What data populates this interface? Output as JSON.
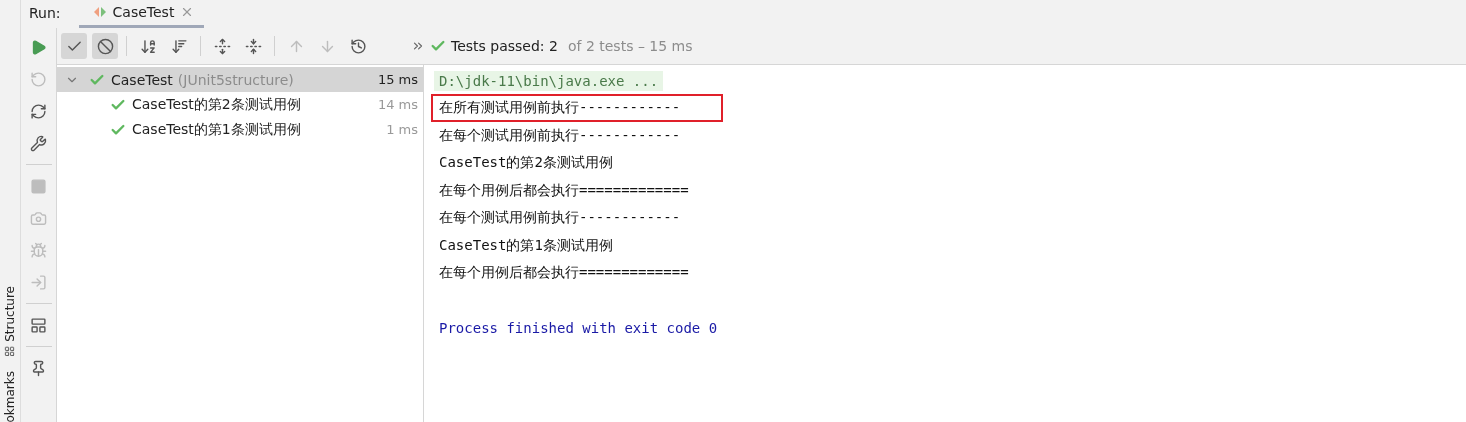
{
  "side_tabs": [
    {
      "label": "Structure"
    },
    {
      "label": "okmarks"
    }
  ],
  "run_bar": {
    "label": "Run:",
    "tab": {
      "label": "CaseTest",
      "selected": true
    }
  },
  "toolbar_buttons": [
    {
      "toggled": true,
      "disabled": false
    },
    {
      "toggled": true,
      "disabled": false
    },
    {
      "toggled": false,
      "disabled": false
    },
    {
      "toggled": false,
      "disabled": false
    },
    {
      "toggled": false,
      "disabled": false
    },
    {
      "toggled": false,
      "disabled": false
    },
    {
      "toggled": false,
      "disabled": true
    },
    {
      "toggled": false,
      "disabled": true
    },
    {
      "toggled": false,
      "disabled": false
    }
  ],
  "status": {
    "summary": "Tests passed: 2",
    "detail": "of 2 tests – 15 ms",
    "passed": true
  },
  "side_buttons": [
    {
      "disabled": false
    },
    {
      "disabled": true
    },
    {
      "disabled": false
    },
    {
      "disabled": false
    },
    {
      "disabled": true
    },
    {
      "disabled": true
    },
    {
      "disabled": true
    },
    {
      "disabled": true
    },
    {
      "disabled": false
    },
    {
      "disabled": false
    }
  ],
  "tree": [
    {
      "name": "CaseTest",
      "detail": "(JUnit5structure)",
      "time": "15 ms",
      "passed": true,
      "selected": true,
      "expanded": true,
      "children": [
        {
          "name": "CaseTest的第2条测试用例",
          "time": "14 ms",
          "passed": true,
          "selected": false
        },
        {
          "name": "CaseTest的第1条测试用例",
          "time": "1 ms",
          "passed": true,
          "selected": false
        }
      ]
    }
  ],
  "console": [
    {
      "kind": "command",
      "text": "D:\\jdk-11\\bin\\java.exe ...",
      "highlighted": false
    },
    {
      "kind": "out",
      "text": "在所有测试用例前执行------------",
      "highlighted": true
    },
    {
      "kind": "out",
      "text": "在每个测试用例前执行------------",
      "highlighted": false
    },
    {
      "kind": "out",
      "text": "CaseTest的第2条测试用例",
      "highlighted": false
    },
    {
      "kind": "out",
      "text": "在每个用例后都会执行=============",
      "highlighted": false
    },
    {
      "kind": "out",
      "text": "在每个测试用例前执行------------",
      "highlighted": false
    },
    {
      "kind": "out",
      "text": "CaseTest的第1条测试用例",
      "highlighted": false
    },
    {
      "kind": "out",
      "text": "在每个用例后都会执行=============",
      "highlighted": false
    },
    {
      "kind": "blank"
    },
    {
      "kind": "exit",
      "text": "Process finished with exit code 0",
      "highlighted": false
    }
  ]
}
